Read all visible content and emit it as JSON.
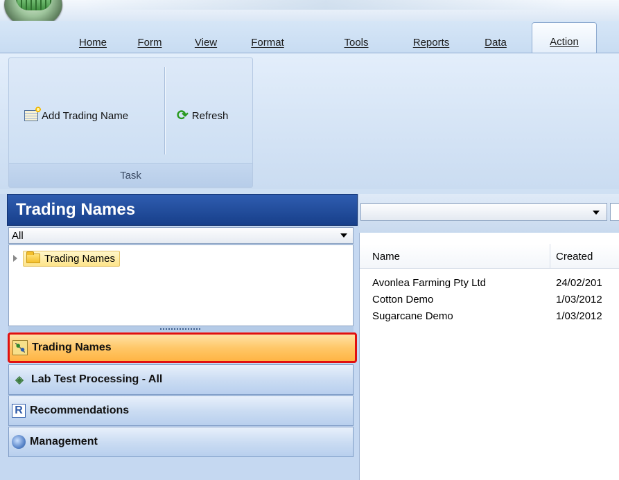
{
  "tabs": [
    {
      "label": "Home",
      "active": false
    },
    {
      "label": "Form",
      "active": false
    },
    {
      "label": "View",
      "active": false
    },
    {
      "label": "Format",
      "active": false
    },
    {
      "label": "Tools",
      "active": false
    },
    {
      "label": "Reports",
      "active": false
    },
    {
      "label": "Data",
      "active": false
    },
    {
      "label": "Action",
      "active": true
    }
  ],
  "ribbon": {
    "add_trading_name_label": "Add Trading Name",
    "refresh_label": "Refresh",
    "group_label": "Task"
  },
  "nav": {
    "title": "Trading Names",
    "filter_value": "All",
    "tree_items": [
      {
        "label": "Trading Names",
        "selected": true
      }
    ],
    "buttons": [
      {
        "label": "Trading Names",
        "icon": "trading-names-icon",
        "active": true
      },
      {
        "label": "Lab Test Processing - All",
        "icon": "lab-test-icon",
        "active": false
      },
      {
        "label": "Recommendations",
        "icon": "recommendations-icon",
        "active": false
      },
      {
        "label": "Management",
        "icon": "management-icon",
        "active": false
      }
    ]
  },
  "grid": {
    "columns": [
      "Name",
      "Created"
    ],
    "rows": [
      {
        "name": "Avonlea Farming Pty Ltd",
        "created": "24/02/201"
      },
      {
        "name": "Cotton Demo",
        "created": "1/03/2012"
      },
      {
        "name": "Sugarcane Demo",
        "created": "1/03/2012"
      }
    ]
  },
  "colors": {
    "nav_header": "#1f4b9c",
    "active_nav_fill": "#ffc869",
    "active_nav_border": "#e01010",
    "tree_selection": "#fde48a"
  }
}
